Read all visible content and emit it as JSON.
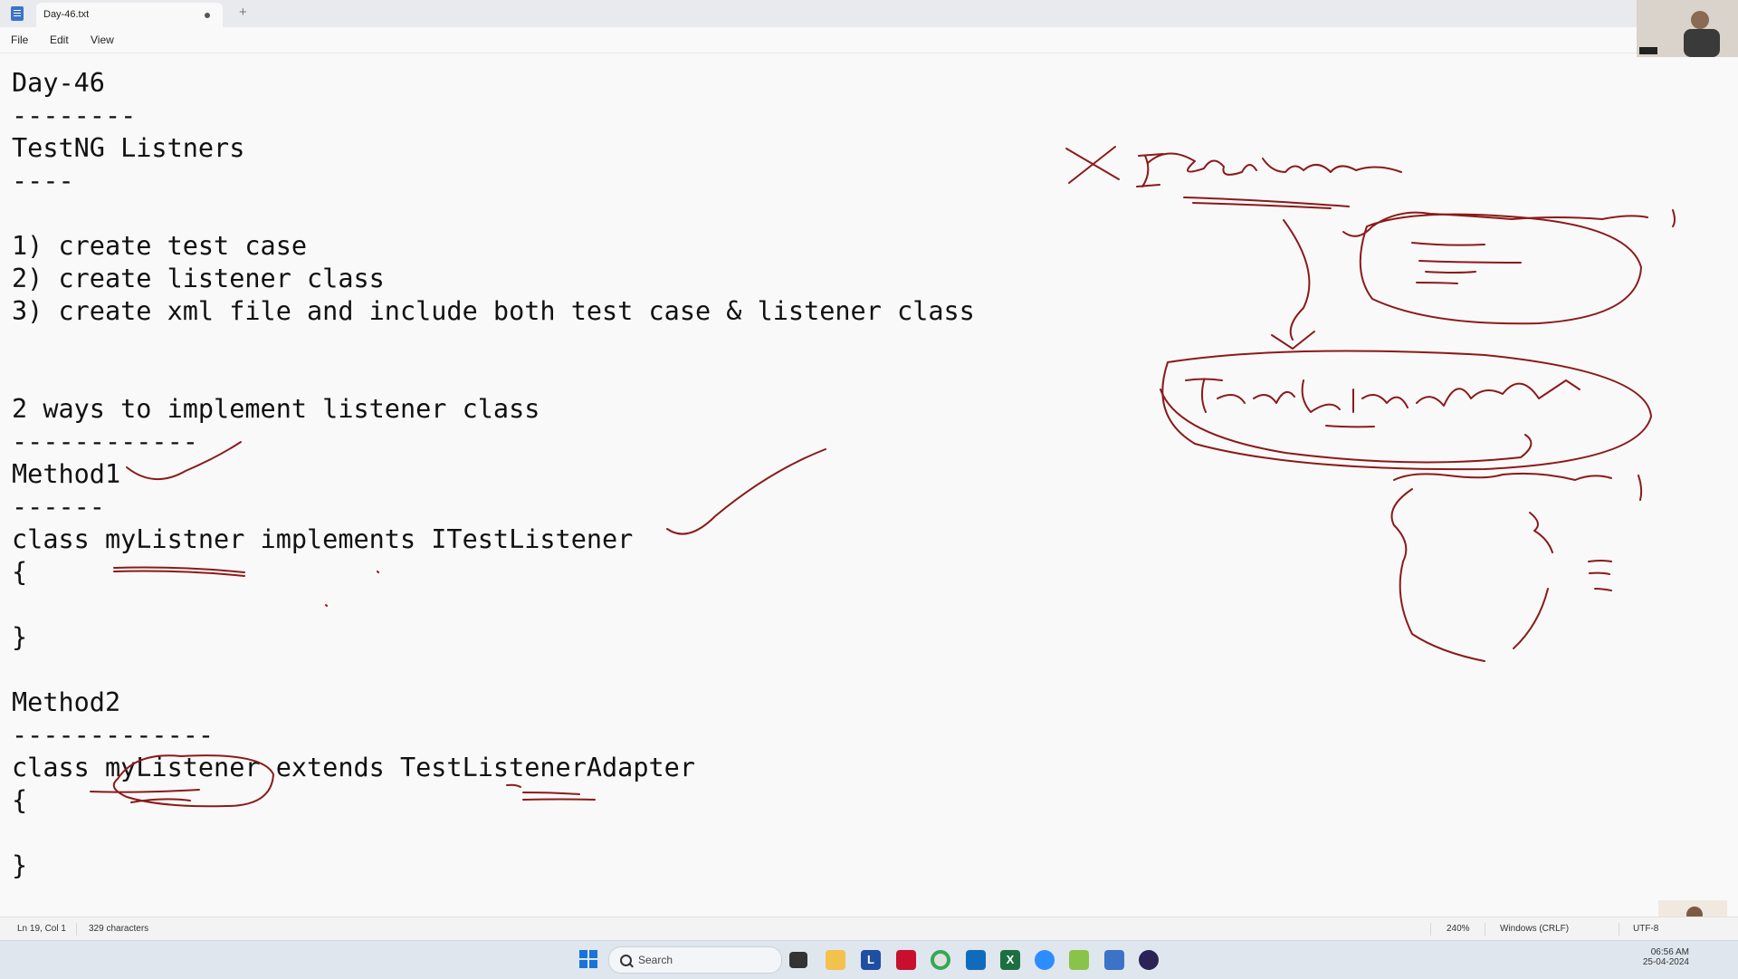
{
  "window": {
    "tab_title": "Day-46.txt",
    "new_tab_symbol": "+"
  },
  "menu": {
    "file": "File",
    "edit": "Edit",
    "view": "View"
  },
  "editor": {
    "lines": [
      "Day-46",
      "--------",
      "TestNG Listners",
      "----",
      "",
      "1) create test case",
      "2) create listener class",
      "3) create xml file and include both test case & listener class",
      "",
      "",
      "2 ways to implement listener class",
      "------------",
      "Method1",
      "------",
      "class myListner implements ITestListener",
      "{",
      "",
      "}",
      "",
      "Method2",
      "-------------",
      "class myListener extends TestListenerAdapter",
      "{",
      "",
      "}"
    ]
  },
  "status": {
    "position": "Ln 19, Col 1",
    "characters": "329 characters",
    "zoom": "240%",
    "line_ending": "Windows (CRLF)",
    "encoding": "UTF-8"
  },
  "taskbar": {
    "search_placeholder": "Search",
    "time": "06:56 AM",
    "date": "25-04-2024",
    "icons": [
      "windows-start-icon",
      "search-icon",
      "task-view-icon",
      "file-explorer-icon",
      "l-app-icon",
      "mcafee-icon",
      "chrome-icon",
      "outlook-icon",
      "excel-icon",
      "zoom-icon",
      "paint-icon",
      "notepad-icon",
      "eclipse-icon"
    ],
    "task_labels": {
      "l_app": "L",
      "excel": "X"
    }
  },
  "colors": {
    "ink": "#8b1a1a",
    "editor_bg": "#f9f9f9",
    "taskbar_bg": "#dfe6ee"
  }
}
